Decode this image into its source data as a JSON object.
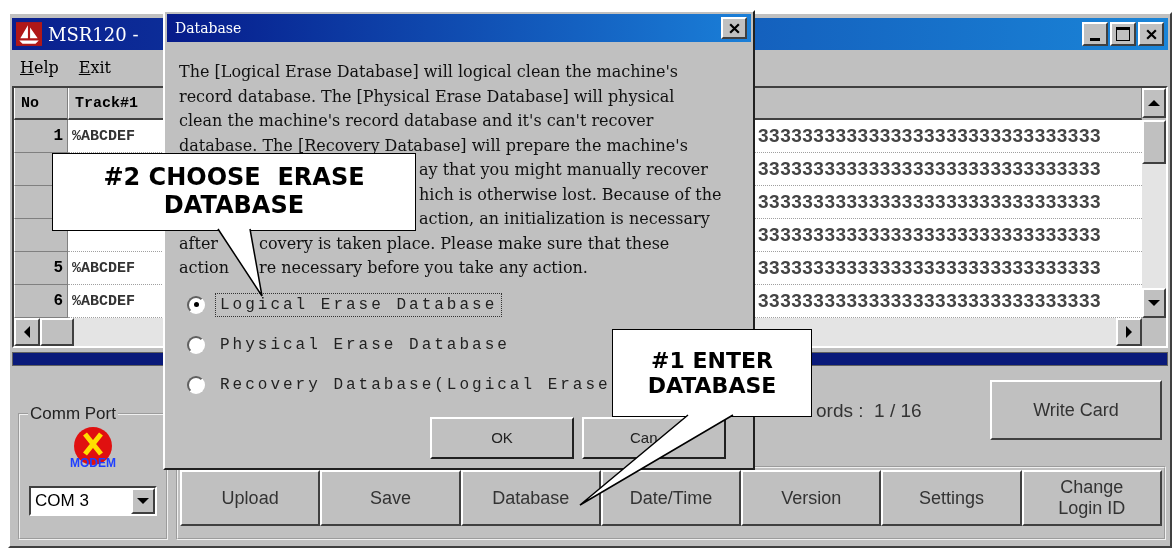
{
  "window": {
    "title": "MSR120 -"
  },
  "menu": [
    {
      "label": "Help"
    },
    {
      "label": "Exit"
    }
  ],
  "grid": {
    "columns": [
      "No",
      "Track#1"
    ],
    "rows": [
      {
        "no": "1",
        "track1": "%ABCDEF",
        "data": "3333333333333333333333333333333"
      },
      {
        "data": "3333333333333333333333333333333"
      },
      {
        "data": "3333333333333333333333333333333"
      },
      {
        "data": "3333333333333333333333333333333"
      },
      {
        "no": "5",
        "track1": "%ABCDEF",
        "data": "3333333333333333333333333333333"
      },
      {
        "no": "6",
        "track1": "%ABCDEF",
        "data": "3333333333333333333333333333333"
      }
    ]
  },
  "comm_port": {
    "label": "Comm Port",
    "modem_label": "MODEM",
    "port": "COM 3"
  },
  "records": "ords :  1 / 16",
  "write_button": "Write Card",
  "buttons": [
    "Upload",
    "Save",
    "Database",
    "Date/Time",
    "Version",
    "Settings",
    "Change Login ID"
  ],
  "dialog": {
    "title": "Database",
    "lines": [
      {
        "kind": "full",
        "parts": [
          "The [Logical Erase Database] will logical clean the machine's"
        ]
      },
      {
        "kind": "full",
        "parts": [
          "record database.  The [Physical Erase Database] will physical"
        ]
      },
      {
        "kind": "full",
        "parts": [
          "clean the machine's record database and it's can't recover"
        ]
      },
      {
        "kind": "full",
        "parts": [
          "database.  The [Recovery Database] will prepare the machine's"
        ]
      },
      {
        "kind": "covered",
        "parts": [
          "ay that you might manually recover"
        ]
      },
      {
        "kind": "covered",
        "parts": [
          "hich is otherwise lost.  Because of the"
        ]
      },
      {
        "kind": "covered",
        "parts": [
          "action, an initialization is necessary"
        ]
      },
      {
        "kind": "split",
        "parts": [
          "after",
          "covery is taken place.  Please make sure that these"
        ]
      },
      {
        "kind": "split",
        "parts": [
          "action",
          "re necessary before you take any action."
        ]
      }
    ],
    "options": [
      {
        "label": "Logical Erase Database",
        "selected": true
      },
      {
        "label": "Physical Erase Database",
        "selected": false
      },
      {
        "label": "Recovery Database(Logical Erase",
        "selected": false
      }
    ],
    "buttons": [
      "OK",
      "Can"
    ]
  },
  "callouts": [
    {
      "text": "#2 CHOOSE  ERASE DATABASE"
    },
    {
      "text": "#1 ENTER DATABASE"
    }
  ]
}
